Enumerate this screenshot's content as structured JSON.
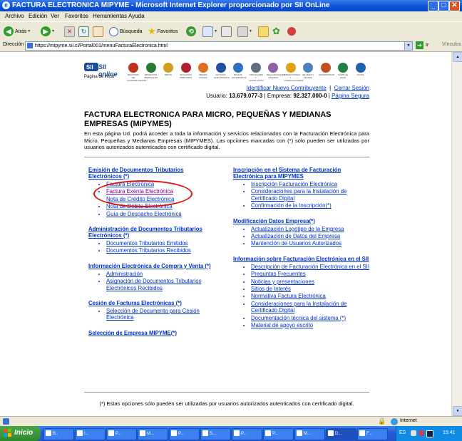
{
  "window": {
    "title": "FACTURA ELECTRONICA MIPYME - Microsoft Internet Explorer proporcionado por SII OnLine",
    "minimize_glyph": "_",
    "maximize_glyph": "□",
    "close_glyph": "✕"
  },
  "menu": [
    "Archivo",
    "Edición",
    "Ver",
    "Favoritos",
    "Herramientas",
    "Ayuda"
  ],
  "toolbar": {
    "back_label": "Atrás",
    "search_label": "Búsqueda",
    "favorites_label": "Favoritos"
  },
  "address": {
    "label": "Dirección",
    "url": "https://mipyme.sii.cl/Portal001/menuFacturaElectronica.html",
    "go_label": "Ir",
    "links_label": "Vínculos"
  },
  "page": {
    "logo_text": "SII online",
    "logo_caption": "Página de inicio",
    "banner_items": [
      {
        "caption": "REGISTRO DE CONTRIBUYENTES",
        "color": "#c03020"
      },
      {
        "caption": "IMPUESTOS MENSUALES",
        "color": "#2a7a30"
      },
      {
        "caption": "RENTA",
        "color": "#d0a020"
      },
      {
        "caption": "SITUACIÓN TRIBUTARIA",
        "color": "#b02030"
      },
      {
        "caption": "BIENES RAÍCES",
        "color": "#e07020"
      },
      {
        "caption": "FACTURA ELECTRÓNICA",
        "color": "#2050a0"
      },
      {
        "caption": "BOLETA HONORARIOS",
        "color": "#3070c0"
      },
      {
        "caption": "CIRCULARES Y LEGISLACIÓN",
        "color": "#607080"
      },
      {
        "caption": "DECLARACIONES JURADAS",
        "color": "#9060a0"
      },
      {
        "caption": "INFRACCIONES Y CONDONACIONES",
        "color": "#e0a010"
      },
      {
        "caption": "VALORES Y FECHAS",
        "color": "#5080c0"
      },
      {
        "caption": "ESTADÍSTICAS",
        "color": "#c05020"
      },
      {
        "caption": "CÓMO SE HACE",
        "color": "#208040"
      },
      {
        "caption": "AYUDA",
        "color": "#2060b0"
      }
    ],
    "top_links": {
      "identify": "Identificar Nuevo Contribuyente",
      "close_session": "Cerrar Sesión"
    },
    "user": {
      "usuario_label": "Usuario:",
      "usuario": "13.679.077-3",
      "empresa_label": "Empresa:",
      "empresa": "92.327.000-0",
      "secure_page": "Página Segura"
    },
    "title": "FACTURA ELECTRONICA PARA MICRO, PEQUEÑAS Y MEDIANAS EMPRESAS (MIPYMES)",
    "intro": "En esta página Ud. podrá acceder a toda la información y servicios relacionados con la Facturación Electrónica para Micro, Pequeñas y Medianas Empresas (MIPYMES). Las opciones marcadas con (*) sólo pueden ser utilizadas por usuarios autorizados autenticados con certificado digital.",
    "left_sections": [
      {
        "title": "Emisión de Documentos Tributarios Electrónicos (*)",
        "items": [
          {
            "label": "Factura Electrónica",
            "visited": false
          },
          {
            "label": "Factura Exenta Electrónica",
            "visited": true
          },
          {
            "label": "Nota de Crédito Electrónica",
            "visited": false
          },
          {
            "label": "Nota de Débito Electrónica",
            "visited": false
          },
          {
            "label": "Guía de Despacho Electrónica",
            "visited": false
          }
        ]
      },
      {
        "title": "Administración de Documentos Tributarios Electrónicos (*)",
        "items": [
          {
            "label": "Documentos Tributarios Emitidos",
            "visited": false
          },
          {
            "label": "Documentos Tributarios Recibidos",
            "visited": false
          }
        ]
      },
      {
        "title": "Información Electrónica de Compra y Venta (*)",
        "items": [
          {
            "label": "Administración",
            "visited": false
          },
          {
            "label": "Asignación de Documentos Tributarios Electrónicos Recibidos",
            "visited": false
          }
        ]
      },
      {
        "title": "Cesión de Facturas Electrónicas (*)",
        "items": [
          {
            "label": "Selección de Documento para Cesión Electrónica",
            "visited": false
          }
        ]
      },
      {
        "title": "Selección de Empresa MIPYME(*)",
        "items": []
      }
    ],
    "right_sections": [
      {
        "title": "Inscripción en el Sistema de Facturación Electrónica para MIPYMES",
        "items": [
          {
            "label": "Inscripción Facturación Electrónica",
            "visited": false
          },
          {
            "label": "Consideraciones para la Instalación de Certificado Digital",
            "visited": false
          },
          {
            "label": "Confirmación de la Inscripción(*)",
            "visited": false
          }
        ]
      },
      {
        "title": "Modificación Datos Empresa(*)",
        "items": [
          {
            "label": "Actualización Logotipo de la Empresa",
            "visited": false
          },
          {
            "label": "Actualización de Datos del Empresa",
            "visited": false
          },
          {
            "label": "Mantención de Usuarios Autorizados",
            "visited": false
          }
        ]
      },
      {
        "title": "Información sobre Facturación Electrónica en el SII",
        "items": [
          {
            "label": "Descripción de Facturación Electrónica en el SII",
            "visited": false
          },
          {
            "label": "Preguntas Frecuentes",
            "visited": false
          },
          {
            "label": "Noticias y presentaciones",
            "visited": false
          },
          {
            "label": "Sitios de Interés",
            "visited": false
          },
          {
            "label": "Normativa Factura Electrónica",
            "visited": false
          },
          {
            "label": "Consideraciones para la Instalación de Certificado Digital",
            "visited": false
          },
          {
            "label": "Documentación técnica del sistema (*)",
            "visited": false
          },
          {
            "label": "Material de apoyo escrito",
            "visited": false
          }
        ]
      }
    ],
    "footnote": "(*) Estas opciones sólo pueden ser utilizadas por usuarios autorizados autenticados con certificado digital."
  },
  "status": {
    "zone": "Internet"
  },
  "taskbar": {
    "start": "Inicio",
    "buttons": [
      "B..",
      "I...",
      "P...",
      "M...",
      "P...",
      "S...",
      "P...",
      "P...",
      "M...",
      "D...",
      "F..."
    ],
    "lang": "ES",
    "clock": "15:41"
  }
}
